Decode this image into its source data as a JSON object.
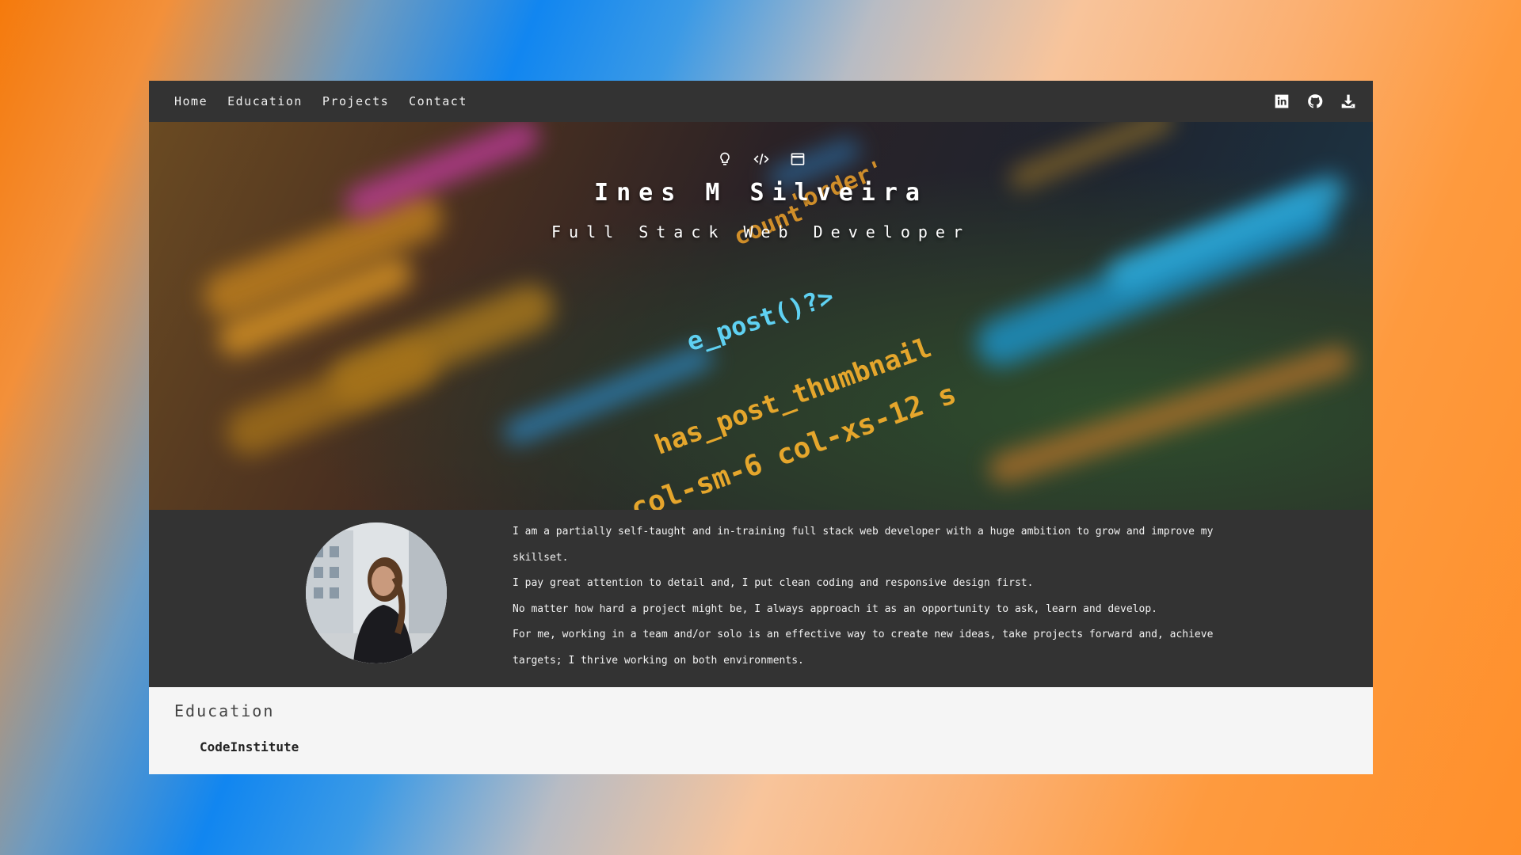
{
  "nav": {
    "links": [
      "Home",
      "Education",
      "Projects",
      "Contact"
    ],
    "icons": [
      "linkedin-icon",
      "github-icon",
      "download-icon"
    ]
  },
  "hero": {
    "icons": [
      "lightbulb-icon",
      "code-icon",
      "browser-window-icon"
    ],
    "title": "Ines M Silveira",
    "subtitle": "Full Stack Web Developer",
    "background_code_lines": [
      "'order'",
      "count'",
      "e_post()?>",
      "has_post_thumbnail",
      "col-sm-6 col-xs-12 s"
    ]
  },
  "about": {
    "paragraphs": [
      "I am a partially self-taught and in-training full stack web developer with a huge ambition to grow and improve my skillset.",
      "I pay great attention to detail and, I put clean coding and responsive design first.",
      "No matter how hard a project might be, I always approach it as an opportunity to ask, learn and develop.",
      "For me, working in a team and/or solo is an effective way to create new ideas, take projects forward and, achieve targets; I thrive working on both environments."
    ]
  },
  "education": {
    "heading": "Education",
    "items": [
      "CodeInstitute"
    ]
  },
  "colors": {
    "nav_bg": "#333333",
    "about_bg": "#333333",
    "page_bg": "#f5f5f5",
    "text_light": "#ffffff"
  }
}
